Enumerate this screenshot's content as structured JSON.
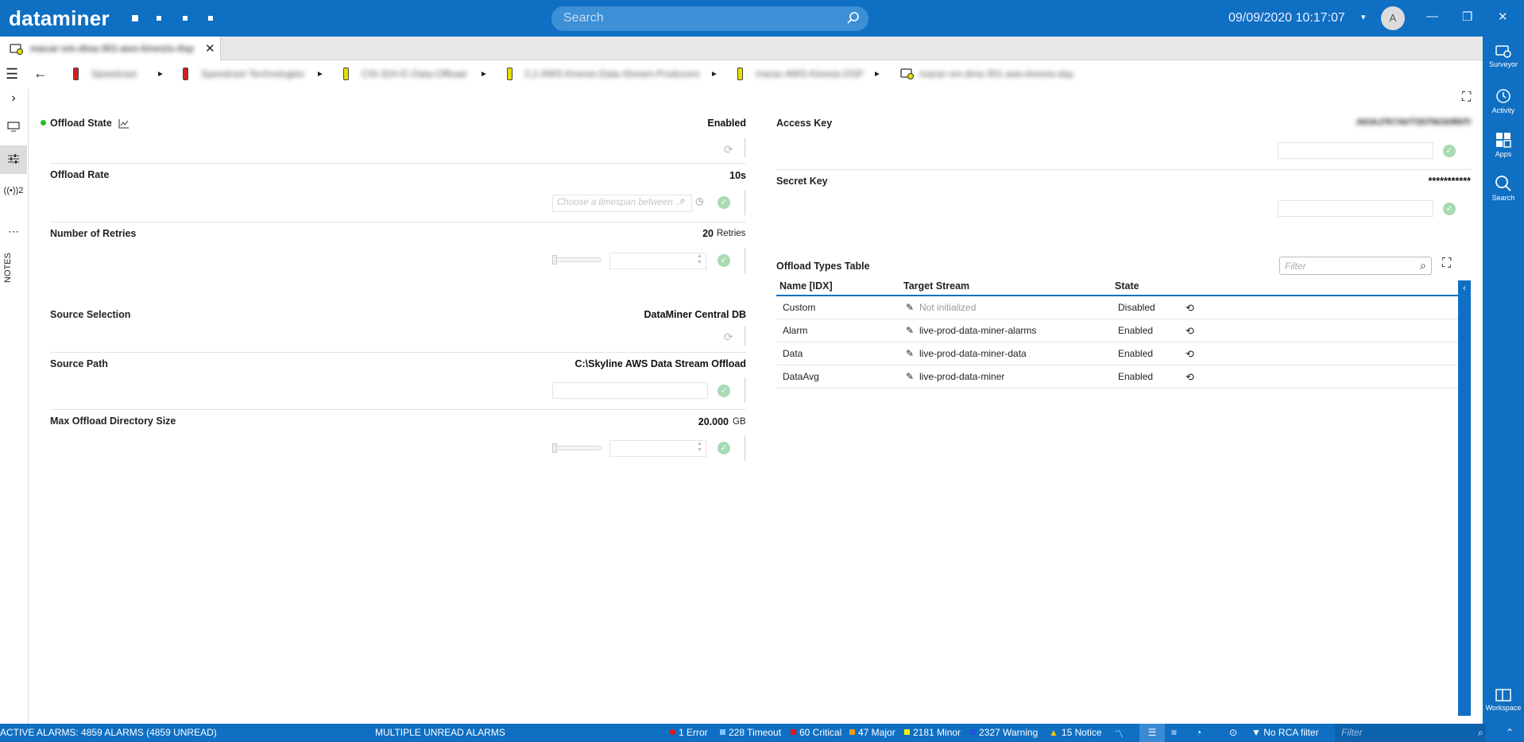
{
  "app": {
    "logo": "dataminer",
    "search_placeholder": "Search",
    "datetime": "09/09/2020 10:17:07",
    "user_initial": "A"
  },
  "tab": {
    "title": "macar-vm-dma-301-aws-kinesis-dsp"
  },
  "breadcrumb": [
    {
      "label": "Speedcast",
      "color": "#d42020"
    },
    {
      "label": "Speedcast Technologies",
      "color": "#d42020"
    },
    {
      "label": "CIS-324-IC-Data-Offload",
      "color": "#e6df00"
    },
    {
      "label": "2.2-AWS-Kinesis-Data-Stream-Producers",
      "color": "#e6df00"
    },
    {
      "label": "macar-AWS-Kinesis-DSP",
      "color": "#e6df00"
    },
    {
      "label": "macar-vm-dma-301-aws-kinesis-dsp",
      "color": "#e6df00"
    }
  ],
  "left_strip": {
    "badge": "2",
    "notes": "NOTES"
  },
  "params": {
    "offload_state": {
      "label": "Offload State",
      "value": "Enabled",
      "status_color": "#22c222"
    },
    "offload_rate": {
      "label": "Offload Rate",
      "value": "10s",
      "placeholder": "Choose a timespan between ..."
    },
    "retries": {
      "label": "Number of Retries",
      "value": "20",
      "unit": "Retries"
    },
    "source_selection": {
      "label": "Source Selection",
      "value": "DataMiner Central DB"
    },
    "source_path": {
      "label": "Source Path",
      "value": "C:\\Skyline AWS Data Stream Offload"
    },
    "max_dir_size": {
      "label": "Max Offload Directory Size",
      "value": "20.000",
      "unit": "GB"
    },
    "access_key": {
      "label": "Access Key",
      "value": "AKIAJ7K7AVT3STNCKRNTI"
    },
    "secret_key": {
      "label": "Secret Key",
      "value": "***********"
    }
  },
  "table": {
    "title": "Offload Types Table",
    "filter_placeholder": "Filter",
    "columns": [
      "Name [IDX]",
      "Target Stream",
      "State"
    ],
    "rows": [
      {
        "name": "Custom",
        "stream": "Not initialized",
        "state": "Disabled"
      },
      {
        "name": "Alarm",
        "stream": "live-prod-data-miner-alarms",
        "state": "Enabled"
      },
      {
        "name": "Data",
        "stream": "live-prod-data-miner-data",
        "state": "Enabled"
      },
      {
        "name": "DataAvg",
        "stream": "live-prod-data-miner",
        "state": "Enabled"
      }
    ]
  },
  "rail": [
    "Surveyor",
    "Activity",
    "Apps",
    "Search",
    "Workspace"
  ],
  "status": {
    "active_alarms": "ACTIVE ALARMS: 4859 ALARMS (4859 UNREAD)",
    "multiple": "MULTIPLE UNREAD ALARMS",
    "counts": [
      {
        "label": "1 Error",
        "color": "#e11"
      },
      {
        "label": "228 Timeout",
        "color": "#7cc6ff"
      },
      {
        "label": "60 Critical",
        "color": "#e11"
      },
      {
        "label": "47 Major",
        "color": "#f39a1b"
      },
      {
        "label": "2181 Minor",
        "color": "#f7f000"
      },
      {
        "label": "2327 Warning",
        "color": "#2452d8"
      },
      {
        "label": "15 Notice",
        "color": "#f7c400"
      }
    ],
    "rca": "No RCA filter",
    "filter_placeholder": "Filter"
  }
}
